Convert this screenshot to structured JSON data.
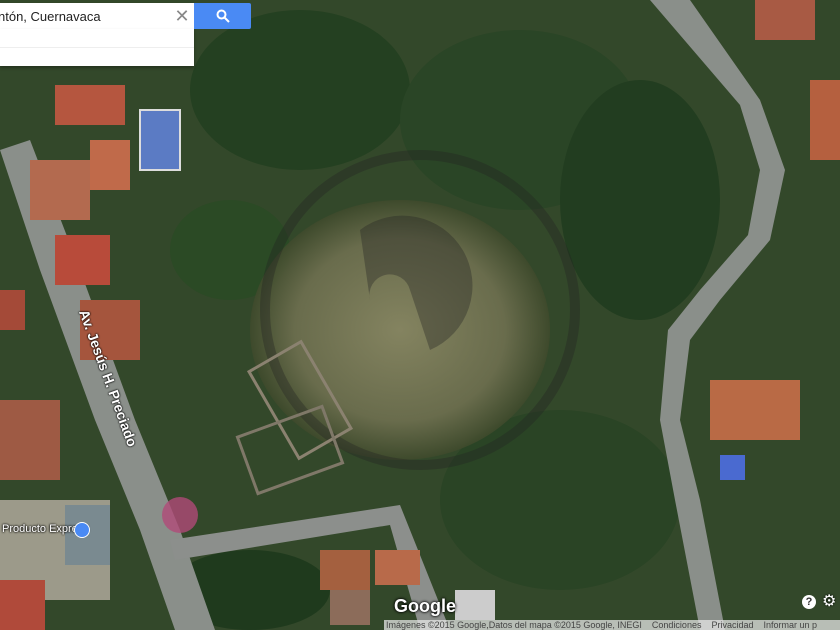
{
  "search": {
    "query": "ntón, Cuernavaca",
    "clear_icon": "close-icon",
    "button_icon": "search-icon"
  },
  "map": {
    "street_label": "Av. Jesús H. Preciado",
    "poi_label": "Producto Express",
    "poi_icon": "shopping-icon",
    "logo": "Google"
  },
  "footer": {
    "imagery": "Imágenes ©2015 Google,Datos del mapa ©2015 Google, INEGI",
    "terms": "Condiciones",
    "privacy": "Privacidad",
    "report": "Informar un p"
  },
  "controls": {
    "help": "?",
    "settings_icon": "gear-icon"
  },
  "colors": {
    "search_button": "#4a8af4",
    "vegetation": "#2f4a22",
    "road": "#8a8f8a"
  }
}
